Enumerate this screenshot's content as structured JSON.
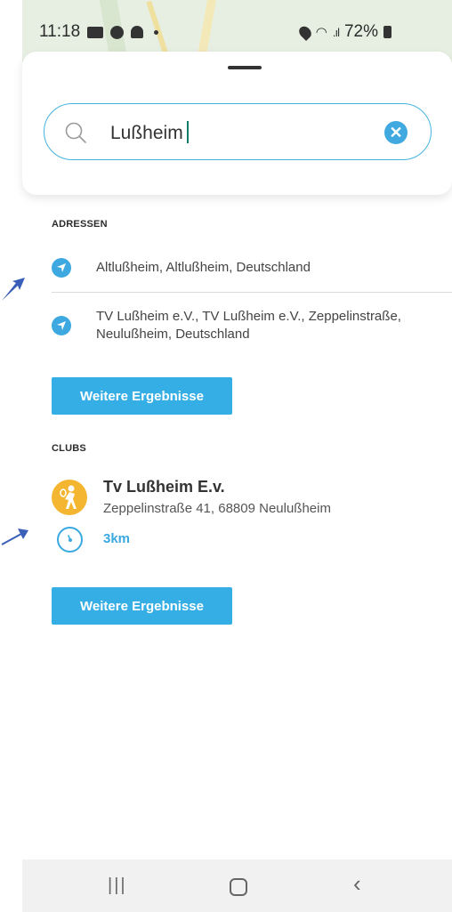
{
  "status_bar": {
    "time": "11:18",
    "battery": "72%"
  },
  "search": {
    "value": "Lußheim",
    "clear_label": "✕"
  },
  "addresses": {
    "title": "ADRESSEN",
    "items": [
      {
        "text": "Altlußheim, Altlußheim, Deutschland"
      },
      {
        "text": "TV Lußheim e.V., TV Lußheim e.V., Zeppelinstraße, Neulußheim, Deutschland"
      }
    ],
    "more_label": "Weitere Ergebnisse"
  },
  "clubs": {
    "title": "CLUBS",
    "items": [
      {
        "name": "Tv Lußheim E.v.",
        "address": "Zeppelinstraße 41, 68809 Neulußheim",
        "distance": "3km"
      }
    ],
    "more_label": "Weitere Ergebnisse"
  },
  "navbar": {
    "recent": "|||",
    "back": "‹"
  },
  "colors": {
    "accent": "#35aee6",
    "club_logo": "#f4b630",
    "annotation_arrow": "#3a5fb8"
  },
  "icons": {
    "search": "search-icon",
    "clear": "clear-icon",
    "address": "location-arrow-icon",
    "club": "tennis-player-icon",
    "distance": "distance-gauge-icon"
  }
}
